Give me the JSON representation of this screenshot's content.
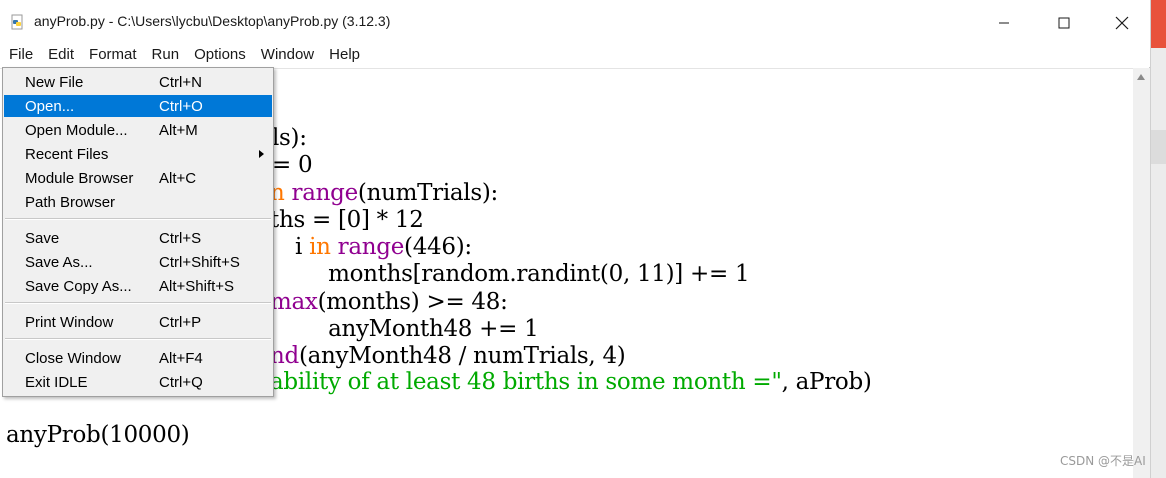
{
  "window": {
    "title": "anyProb.py - C:\\Users\\lycbu\\Desktop\\anyProb.py (3.12.3)",
    "icon": "python-file-icon"
  },
  "menubar": {
    "items": [
      "File",
      "Edit",
      "Format",
      "Run",
      "Options",
      "Window",
      "Help"
    ],
    "active": "File"
  },
  "file_menu": {
    "items": [
      {
        "label": "New File",
        "shortcut": "Ctrl+N"
      },
      {
        "label": "Open...",
        "shortcut": "Ctrl+O",
        "highlighted": true
      },
      {
        "label": "Open Module...",
        "shortcut": "Alt+M"
      },
      {
        "label": "Recent Files",
        "shortcut": "",
        "submenu": true
      },
      {
        "label": "Module Browser",
        "shortcut": "Alt+C"
      },
      {
        "label": "Path Browser",
        "shortcut": ""
      },
      {
        "label": "Save",
        "shortcut": "Ctrl+S"
      },
      {
        "label": "Save As...",
        "shortcut": "Ctrl+Shift+S"
      },
      {
        "label": "Save Copy As...",
        "shortcut": "Alt+Shift+S"
      },
      {
        "label": "Print Window",
        "shortcut": "Ctrl+P"
      },
      {
        "label": "Close Window",
        "shortcut": "Alt+F4"
      },
      {
        "label": "Exit IDLE",
        "shortcut": "Ctrl+Q"
      }
    ]
  },
  "editor": {
    "visible_fragments": [
      {
        "segments": [
          {
            "t": "ls):",
            "c": ""
          }
        ]
      },
      {
        "segments": [
          {
            "t": "= 0",
            "c": ""
          }
        ]
      },
      {
        "segments": [
          {
            "t": "n",
            "c": "kw"
          },
          {
            "t": " ",
            "c": ""
          },
          {
            "t": "range",
            "c": "bi"
          },
          {
            "t": "(numTrials):",
            "c": ""
          }
        ]
      },
      {
        "segments": [
          {
            "t": "ths = [0] * 12",
            "c": ""
          }
        ]
      },
      {
        "segments": [
          {
            "t": " i ",
            "c": ""
          },
          {
            "t": "in",
            "c": "kw"
          },
          {
            "t": " ",
            "c": ""
          },
          {
            "t": "range",
            "c": "bi"
          },
          {
            "t": "(446):",
            "c": ""
          }
        ]
      },
      {
        "segments": [
          {
            "t": "      months[random.randint(0, 11)] += 1",
            "c": ""
          }
        ]
      },
      {
        "segments": [
          {
            "t": "max",
            "c": "bi"
          },
          {
            "t": "(months) >= 48:",
            "c": ""
          }
        ]
      },
      {
        "segments": [
          {
            "t": "      anyMonth48 += 1",
            "c": ""
          }
        ]
      },
      {
        "segments": [
          {
            "t": "nd",
            "c": "bi"
          },
          {
            "t": "(anyMonth48 / numTrials, 4)",
            "c": ""
          }
        ]
      },
      {
        "segments": [
          {
            "t": "ability of at least 48 births in some month =\"",
            "c": "str"
          },
          {
            "t": ", aProb)",
            "c": ""
          }
        ]
      }
    ],
    "last_line": "anyProb(10000)"
  },
  "watermark": "CSDN @不是AI"
}
